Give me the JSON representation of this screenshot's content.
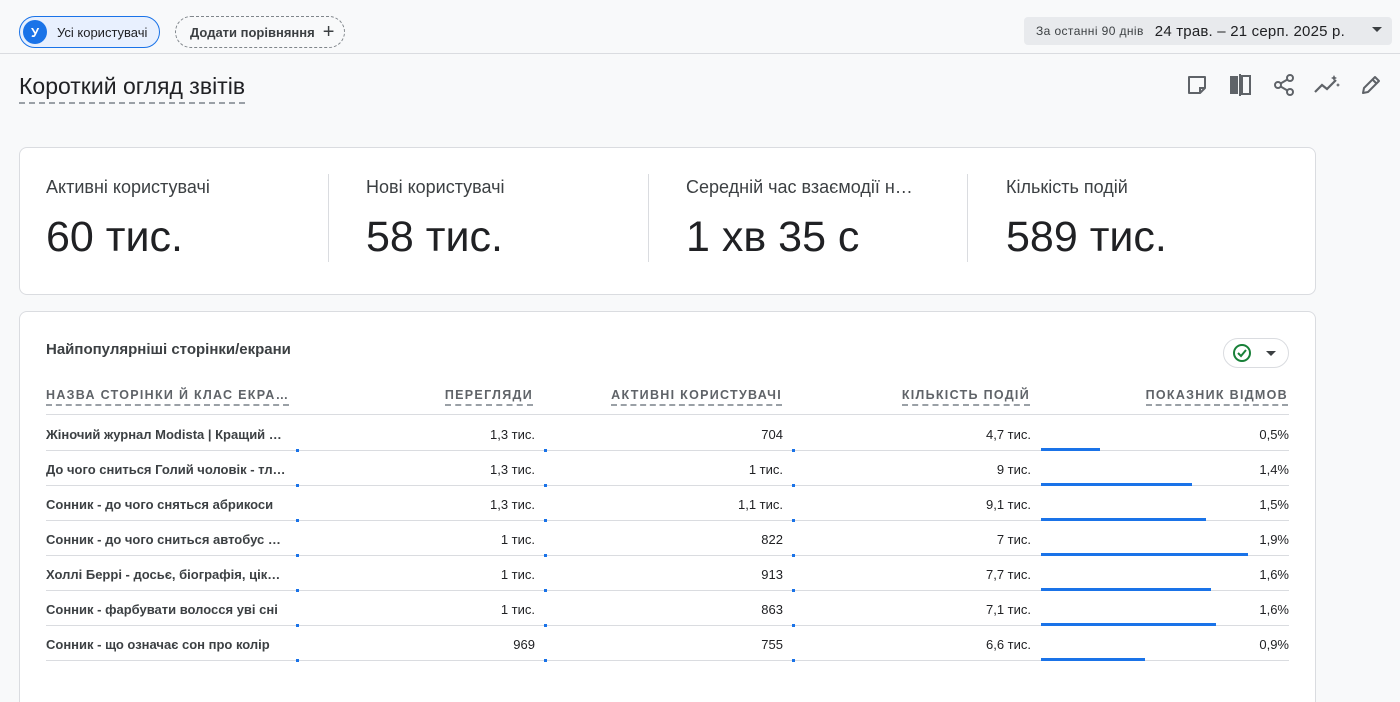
{
  "header": {
    "segment_avatar": "У",
    "segment_label": "Усі користувачі",
    "add_comparison_label": "Додати порівняння",
    "date_preset": "За останні 90 днів",
    "date_range": "24 трав. – 21 серп. 2025 р."
  },
  "page_title": "Короткий огляд звітів",
  "toolbar_icons": [
    "note-icon",
    "compare-columns-icon",
    "share-icon",
    "insights-icon",
    "edit-icon"
  ],
  "metrics": [
    {
      "label": "Активні користувачі",
      "value": "60 тис."
    },
    {
      "label": "Нові користувачі",
      "value": "58 тис."
    },
    {
      "label": "Середній час взаємодії н…",
      "value": "1 хв 35 с"
    },
    {
      "label": "Кількість подій",
      "value": "589 тис."
    }
  ],
  "table": {
    "title": "Найпопулярніші сторінки/екрани",
    "columns": [
      "НАЗВА СТОРІНКИ Й КЛАС ЕКРА…",
      "ПЕРЕГЛЯДИ",
      "АКТИВНІ КОРИСТУВАЧІ",
      "КІЛЬКІСТЬ ПОДІЙ",
      "ПОКАЗНИК ВІДМОВ"
    ],
    "rows": [
      {
        "name": "Жіночий журнал Modista | Кращий жіночий сайт",
        "views": "1,3 тис.",
        "users": "704",
        "events": "4,7 тис.",
        "bounce": "0,5%",
        "bounce_share": 0.24
      },
      {
        "name": "До чого сниться Голий чоловік - тлумачення",
        "views": "1,3 тис.",
        "users": "1 тис.",
        "events": "9 тис.",
        "bounce": "1,4%",
        "bounce_share": 0.61
      },
      {
        "name": "Сонник - до чого сняться абрикоси",
        "views": "1,3 тис.",
        "users": "1,1 тис.",
        "events": "9,1 тис.",
        "bounce": "1,5%",
        "bounce_share": 0.67
      },
      {
        "name": "Сонник - до чого сниться автобус у сні",
        "views": "1 тис.",
        "users": "822",
        "events": "7 тис.",
        "bounce": "1,9%",
        "bounce_share": 0.84
      },
      {
        "name": "Холлі Беррі - досьє, біографія, цікаві факти",
        "views": "1 тис.",
        "users": "913",
        "events": "7,7 тис.",
        "bounce": "1,6%",
        "bounce_share": 0.69
      },
      {
        "name": "Сонник - фарбувати волосся уві сні",
        "views": "1 тис.",
        "users": "863",
        "events": "7,1 тис.",
        "bounce": "1,6%",
        "bounce_share": 0.71
      },
      {
        "name": "Сонник - що означає сон про колір",
        "views": "969",
        "users": "755",
        "events": "6,6 тис.",
        "bounce": "0,9%",
        "bounce_share": 0.42
      }
    ]
  },
  "colors": {
    "accent": "#1a73e8",
    "check_green": "#188038"
  }
}
